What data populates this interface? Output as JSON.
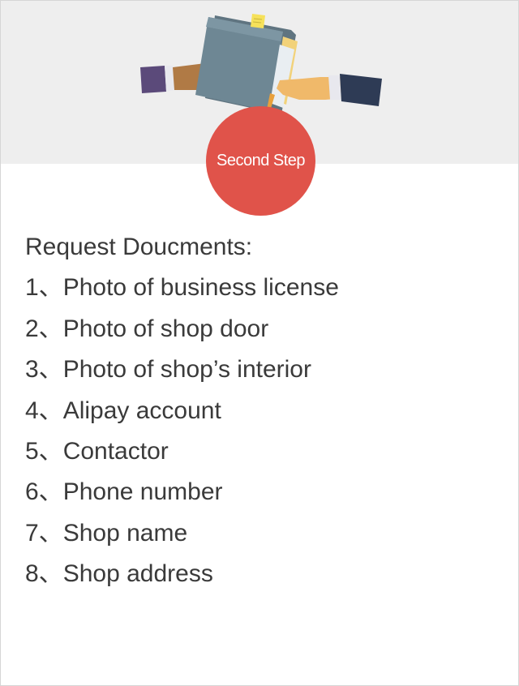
{
  "step": {
    "label": "Second Step",
    "badge_color": "#e0534a"
  },
  "banner": {
    "background": "#eeeeee",
    "illustration": "hands-exchanging-folder-icon"
  },
  "documents": {
    "heading": "Request Doucments:",
    "items": [
      {
        "number": "1、",
        "text": "Photo of business license"
      },
      {
        "number": "2、",
        "text": "Photo of shop door"
      },
      {
        "number": "3、",
        "text": "Photo of shop’s interior"
      },
      {
        "number": "4、",
        "text": "Alipay account"
      },
      {
        "number": "5、",
        "text": "Contactor"
      },
      {
        "number": "6、",
        "text": "Phone number"
      },
      {
        "number": "7、",
        "text": "Shop name"
      },
      {
        "number": "8、",
        "text": "Shop address"
      }
    ]
  }
}
